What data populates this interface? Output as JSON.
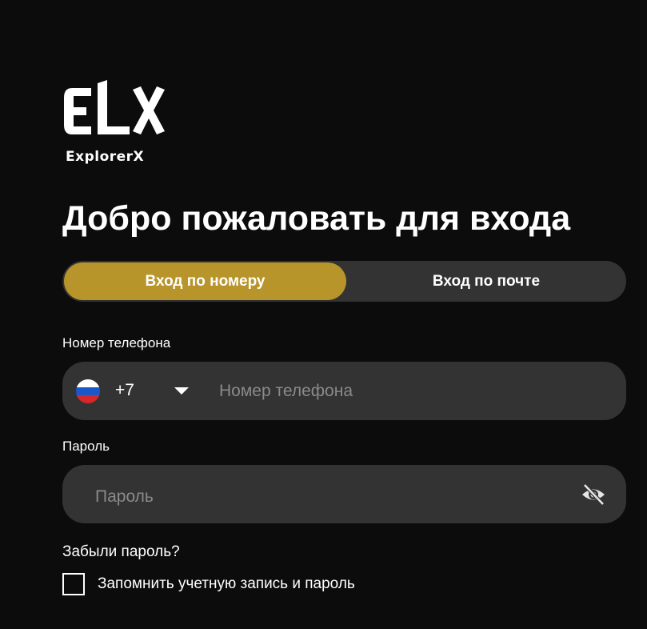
{
  "brand": {
    "logo_text": "ELX",
    "name": "ExplorerX"
  },
  "header": {
    "title": "Добро пожаловать для входа"
  },
  "tabs": {
    "phone_label": "Вход по номеру",
    "email_label": "Вход по почте",
    "active": "phone"
  },
  "phone": {
    "label": "Номер телефона",
    "country_flag": "russia-flag-icon",
    "country_code": "+7",
    "value": "",
    "placeholder": "Номер телефона"
  },
  "password": {
    "label": "Пароль",
    "value": "",
    "placeholder": "Пароль",
    "visibility_icon": "eye-off-icon"
  },
  "links": {
    "forgot_password": "Забыли пароль?"
  },
  "remember": {
    "label": "Запомнить учетную запись и пароль",
    "checked": false
  },
  "colors": {
    "background": "#0c0c0c",
    "field_background": "#333333",
    "accent": "#b8952a",
    "text": "#ffffff",
    "placeholder": "#8a8a8a"
  }
}
